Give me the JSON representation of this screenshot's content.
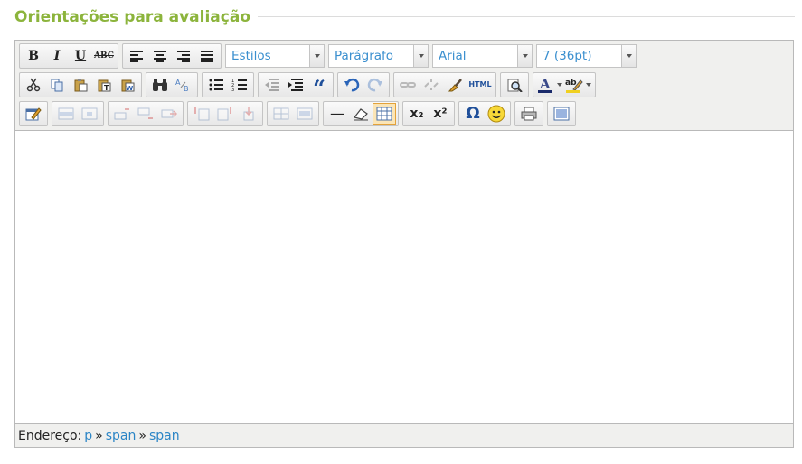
{
  "section": {
    "title": "Orientações para avaliação"
  },
  "toolbar": {
    "styles_value": "Estilos",
    "format_value": "Parágrafo",
    "font_value": "Arial",
    "size_value": "7 (36pt)",
    "bold_label": "B",
    "italic_label": "I",
    "underline_label": "U",
    "strike_label": "ABC",
    "blockquote_label": "“",
    "html_label": "HTML",
    "hr_label": "—",
    "sub_label": "x₂",
    "sup_label": "x²",
    "charmap_label": "Ω",
    "emotions_label": "☺"
  },
  "statusbar": {
    "label": "Endereço:",
    "path": [
      "p",
      "span",
      "span"
    ],
    "separator": "»"
  },
  "colors": {
    "title": "#8cb43c",
    "link": "#2b85c6",
    "toolbar_bg": "#f0f0ee"
  }
}
